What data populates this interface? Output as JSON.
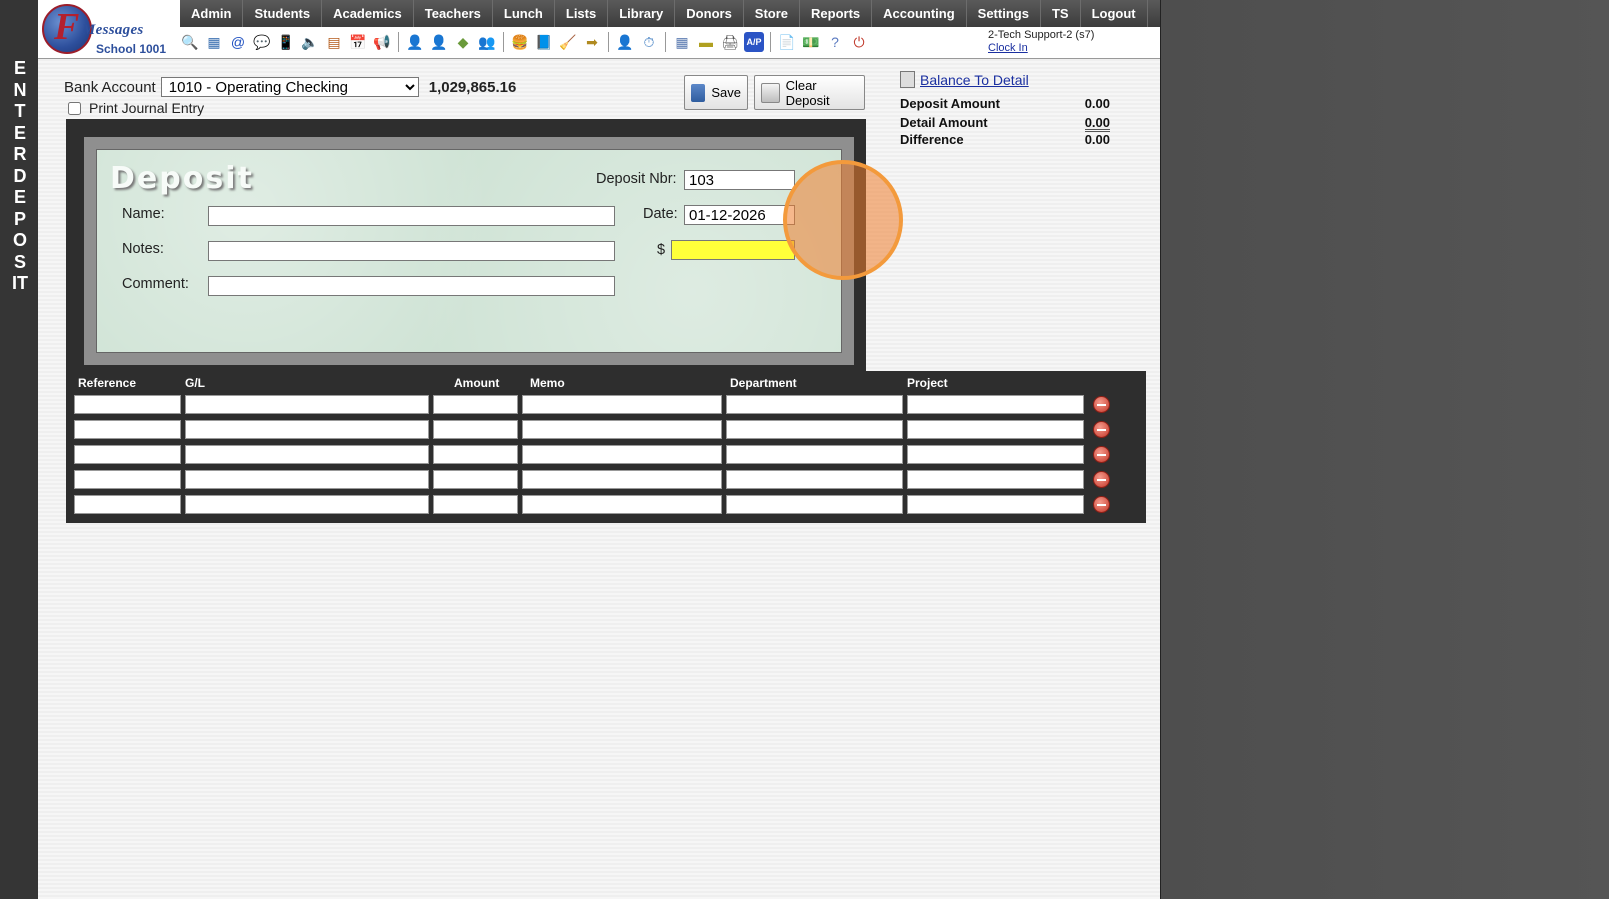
{
  "page": {
    "vertical_title": "ENTER DEPOSIT",
    "focus_highlight_color": "#ee7d2d"
  },
  "header": {
    "logo": {
      "brand": "Messages",
      "letter": "F",
      "school": "School 1001"
    },
    "nav": [
      "Admin",
      "Students",
      "Academics",
      "Teachers",
      "Lunch",
      "Lists",
      "Library",
      "Donors",
      "Store",
      "Reports",
      "Accounting",
      "Settings",
      "TS",
      "Logout"
    ],
    "toolbar_icons": [
      {
        "name": "search-icon",
        "glyph": "🔍",
        "color": "#333"
      },
      {
        "name": "grid-icon",
        "glyph": "▦",
        "color": "#3a6fb0"
      },
      {
        "name": "email-icon",
        "glyph": "@",
        "color": "#1d4fc0"
      },
      {
        "name": "chat-icon",
        "glyph": "💬",
        "color": "#2e8b2e"
      },
      {
        "name": "mobile-icon",
        "glyph": "📱",
        "color": "#333"
      },
      {
        "name": "speaker-icon",
        "glyph": "🔈",
        "color": "#555"
      },
      {
        "name": "form-icon",
        "glyph": "▤",
        "color": "#b35a1a"
      },
      {
        "name": "calendar-icon",
        "glyph": "📅",
        "color": "#c0392b"
      },
      {
        "name": "megaphone-icon",
        "glyph": "📢",
        "color": "#8a5a1a"
      },
      {
        "sep": true
      },
      {
        "name": "student-icon",
        "glyph": "👤",
        "color": "#c47a2a"
      },
      {
        "name": "teacher-icon",
        "glyph": "👤",
        "color": "#8a6a2a"
      },
      {
        "name": "eraser-icon",
        "glyph": "◆",
        "color": "#6a9a3a"
      },
      {
        "name": "family-icon",
        "glyph": "👥",
        "color": "#7a4a2a"
      },
      {
        "sep": true
      },
      {
        "name": "lunch-icon",
        "glyph": "🍔",
        "color": "#b07a20"
      },
      {
        "name": "book-icon",
        "glyph": "📘",
        "color": "#3a5aa0"
      },
      {
        "name": "broom-icon",
        "glyph": "🧹",
        "color": "#c0a020"
      },
      {
        "name": "arrow-right-icon",
        "glyph": "➡",
        "color": "#b08a20"
      },
      {
        "sep": true
      },
      {
        "name": "person-icon",
        "glyph": "👤",
        "color": "#555"
      },
      {
        "name": "clock-icon",
        "glyph": "⏱",
        "color": "#3a7ac0"
      },
      {
        "sep": true
      },
      {
        "name": "ledger-icon",
        "glyph": "▦",
        "color": "#5a7ab0"
      },
      {
        "name": "card-icon",
        "glyph": "▬",
        "color": "#b0a020"
      },
      {
        "name": "printer-icon",
        "glyph": "🖨",
        "color": "#555"
      },
      {
        "name": "ap-icon",
        "glyph": "A/P",
        "color": "#1d4fc0"
      },
      {
        "sep": true
      },
      {
        "name": "pdf-icon",
        "glyph": "📄",
        "color": "#c0392b"
      },
      {
        "name": "money-icon",
        "glyph": "💵",
        "color": "#3a6a3a"
      },
      {
        "name": "help-icon",
        "glyph": "?",
        "color": "#5a7ac0"
      },
      {
        "name": "power-icon",
        "glyph": "⏻",
        "color": "#c0392b"
      }
    ],
    "user": {
      "name": "2-Tech Support-2 (s7)",
      "clock_in": "Clock In"
    }
  },
  "form": {
    "bank_label": "Bank Account",
    "bank_selected": "1010 - Operating Checking",
    "bank_balance": "1,029,865.16",
    "print_journal_label": "Print Journal Entry",
    "print_journal_checked": false,
    "save_label": "Save",
    "clear_label": "Clear Deposit"
  },
  "balance": {
    "link_label": "Balance To Detail",
    "rows": [
      {
        "label": "Deposit Amount",
        "value": "0.00"
      },
      {
        "label": "Detail Amount",
        "value": "0.00"
      },
      {
        "label": "Difference",
        "value": "0.00"
      }
    ]
  },
  "deposit": {
    "title": "Deposit",
    "name_label": "Name:",
    "notes_label": "Notes:",
    "comment_label": "Comment:",
    "deposit_nbr_label": "Deposit Nbr:",
    "deposit_nbr_value": "103",
    "date_label": "Date:",
    "date_value": "01-12-2026",
    "dollar_label": "$",
    "name_value": "",
    "notes_value": "",
    "comment_value": "",
    "amount_value": "",
    "amount_highlight_color": "#ffff3a"
  },
  "detail": {
    "columns": [
      "Reference",
      "G/L",
      "Amount",
      "Memo",
      "Department",
      "Project"
    ],
    "rows": [
      [
        "",
        "",
        "",
        "",
        "",
        ""
      ],
      [
        "",
        "",
        "",
        "",
        "",
        ""
      ],
      [
        "",
        "",
        "",
        "",
        "",
        ""
      ],
      [
        "",
        "",
        "",
        "",
        "",
        ""
      ],
      [
        "",
        "",
        "",
        "",
        "",
        ""
      ]
    ]
  }
}
